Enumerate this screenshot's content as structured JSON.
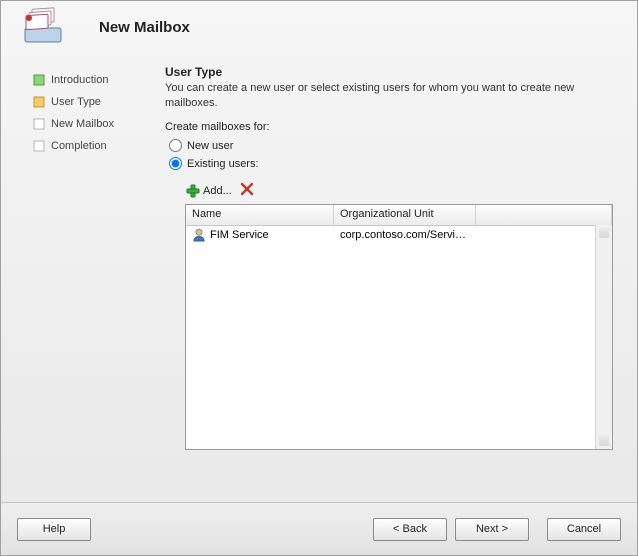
{
  "header": {
    "title": "New Mailbox"
  },
  "sidebar": {
    "steps": [
      {
        "label": "Introduction",
        "state": "done"
      },
      {
        "label": "User Type",
        "state": "current"
      },
      {
        "label": "New Mailbox",
        "state": "pending"
      },
      {
        "label": "Completion",
        "state": "pending"
      }
    ]
  },
  "main": {
    "section_title": "User Type",
    "section_desc": "You can create a new user or select existing users for whom you want to create new mailboxes.",
    "create_label": "Create mailboxes for:",
    "radio_new_user": "New user",
    "radio_existing_users": "Existing users:",
    "selected_radio": "existing",
    "add_label": "Add...",
    "columns": {
      "name": "Name",
      "ou": "Organizational Unit"
    },
    "rows": [
      {
        "name": "FIM Service",
        "ou": "corp.contoso.com/Service..."
      }
    ]
  },
  "footer": {
    "help": "Help",
    "back": "< Back",
    "next": "Next >",
    "cancel": "Cancel"
  }
}
